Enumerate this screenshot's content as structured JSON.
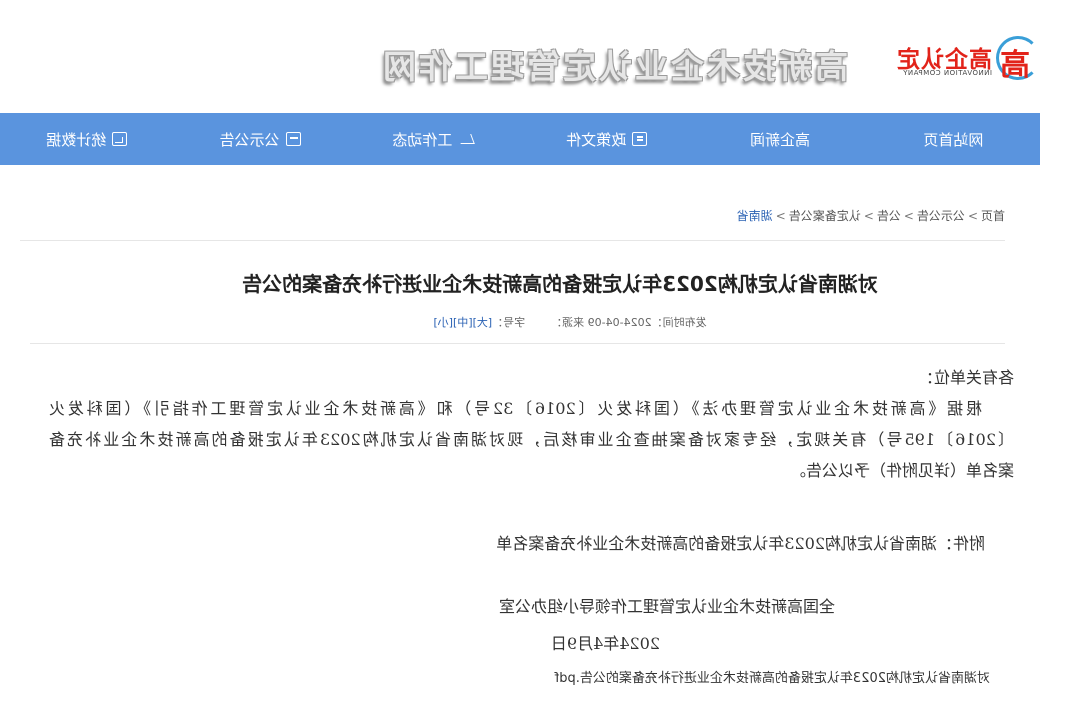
{
  "header": {
    "logo_mark": "高",
    "logo_cn": "高企认定",
    "logo_en": "INNOVATION COMPANY",
    "site_title": "高新技术企业认定管理工作网"
  },
  "nav": {
    "items": [
      {
        "label": "网站首页",
        "icon": ""
      },
      {
        "label": "高企新闻",
        "icon": ""
      },
      {
        "label": "政策文件",
        "icon": "document-icon"
      },
      {
        "label": "工作动态",
        "icon": "paper-plane-icon"
      },
      {
        "label": "公示公告",
        "icon": "inbox-icon"
      },
      {
        "label": "统计数据",
        "icon": "chart-icon"
      }
    ]
  },
  "breadcrumb": {
    "items": [
      "首页",
      "公示公告",
      "公告",
      "认定备案公告",
      "湖南省"
    ],
    "separator": ">"
  },
  "article": {
    "title": "对湖南省认定机构2023年认定报备的高新技术企业进行补充备案的公告",
    "meta_publish": "发布时间：2024-04-09 来源：",
    "meta_font_label": "字号：",
    "meta_size_large": "[大]",
    "meta_size_medium": "[中]",
    "meta_size_small": "[小]",
    "greeting": "各有关单位：",
    "para_line1": "根据《高新技术企业认定管理办法》（国科发火〔2016〕32号）和《高新技术企业认定管理工作指引》（国科发火",
    "para_line2": "〔2016〕195号）有关规定，经专家对备案抽查企业审核后，现对湖南省认定机构2023年认定报备的高新技术企业补充备",
    "para_line3": "案名单（详见附件）予以公告。",
    "attachment": "附件：湖南省认定机构2023年认定报备的高新技术企业补充备案名单",
    "sign_org": "全国高新技术企业认定管理工作领导小组办公室",
    "sign_date": "2024年4月9日",
    "pdf_link": "对湖南省认定机构2023年认定报备的高新技术企业进行补充备案的公告.pdf"
  },
  "colors": {
    "nav_bg": "#5a94de",
    "logo_red": "#e2231a",
    "logo_blue": "#3a9fd8",
    "link_blue": "#2b62b4"
  }
}
